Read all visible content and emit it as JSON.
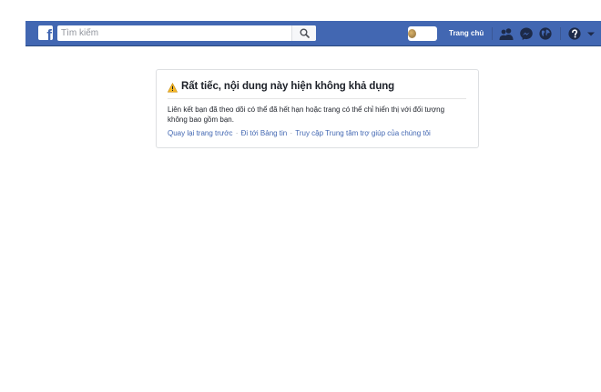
{
  "header": {
    "logo_letter": "f",
    "search_placeholder": "Tìm kiếm",
    "home_label": "Trang chủ",
    "icons": [
      "friends-icon",
      "messenger-icon",
      "notifications-globe-icon",
      "help-icon",
      "dropdown-arrow-icon"
    ],
    "brand_color": "#4267b2"
  },
  "content": {
    "title": "Rất tiếc, nội dung này hiện không khả dụng",
    "message": "Liên kết bạn đã theo dõi có thể đã hết hạn hoặc trang có thể chỉ hiển thị với đối tượng không bao gồm bạn.",
    "links": {
      "back": "Quay lại trang trước",
      "separator": "·",
      "news_feed": "Đi tới Bảng tin",
      "help": "Truy cập Trung tâm trợ giúp của chúng tôi"
    },
    "warning_color": "#f7b928"
  }
}
